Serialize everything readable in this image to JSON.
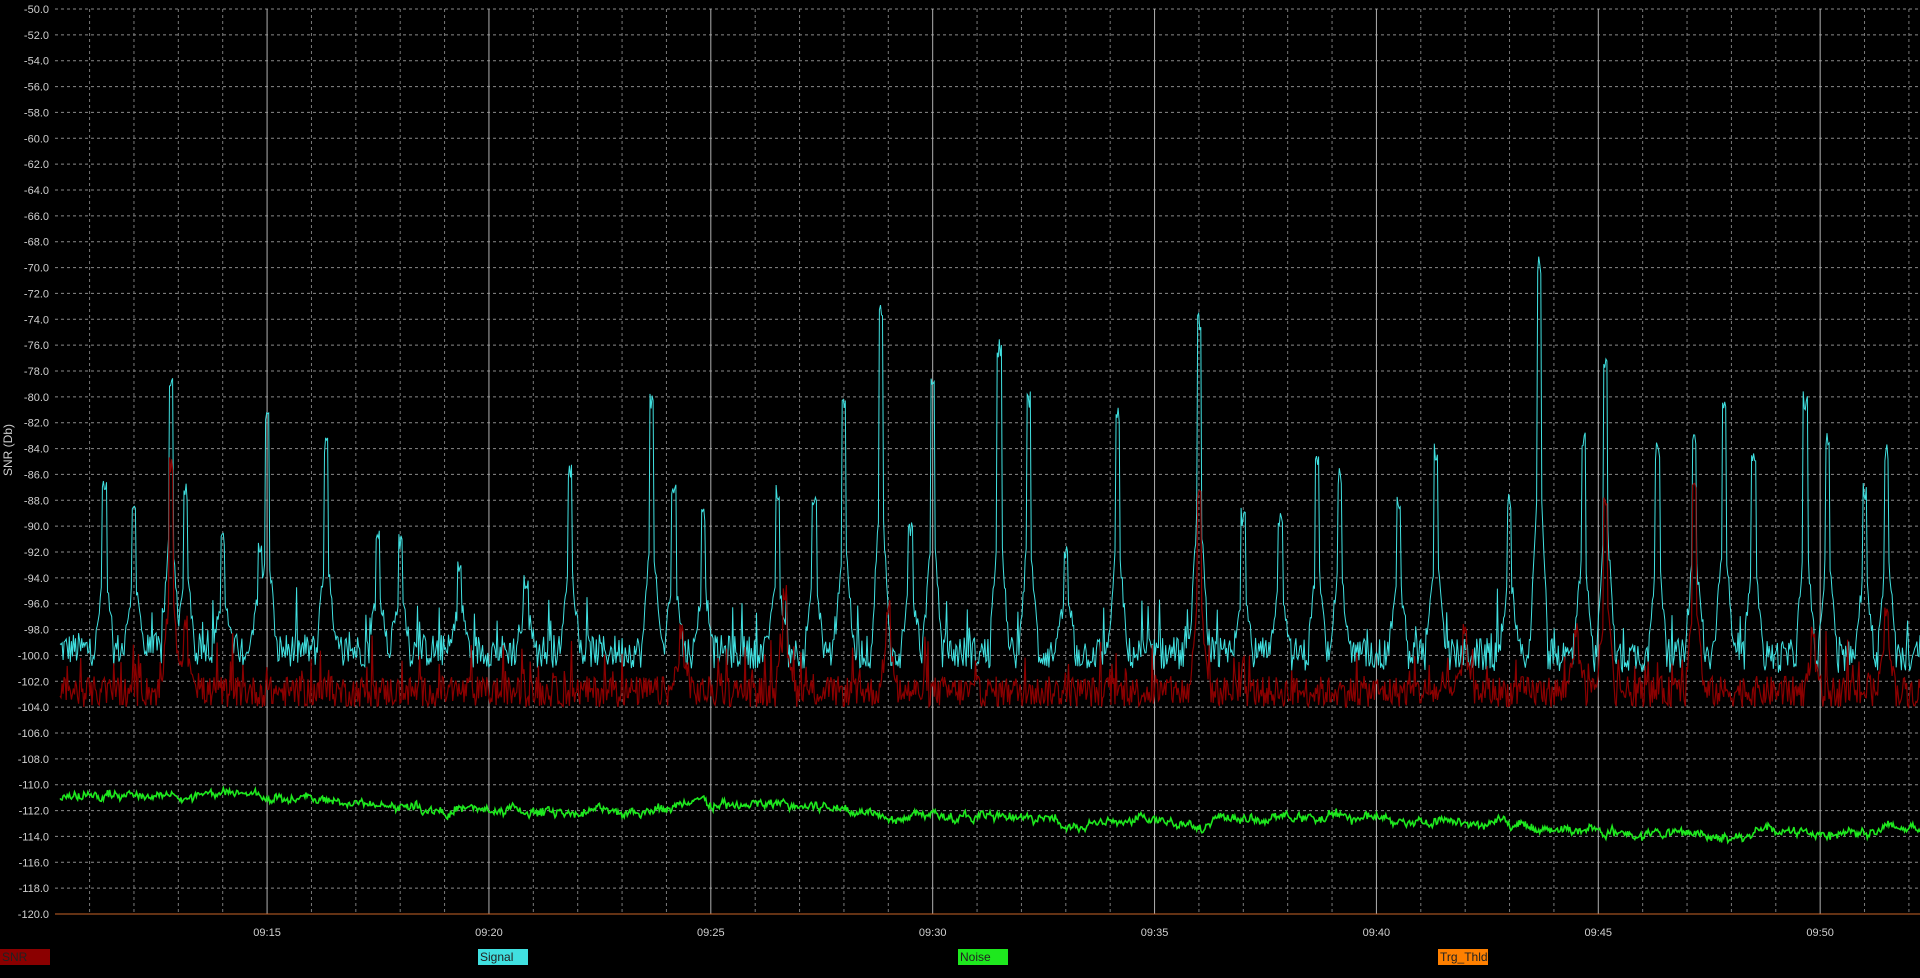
{
  "chart_data": {
    "type": "line",
    "ylabel": "SNR (Db)",
    "ylim": [
      -120,
      -50
    ],
    "yticks": [
      "-50.0",
      "-52.0",
      "-54.0",
      "-56.0",
      "-58.0",
      "-60.0",
      "-62.0",
      "-64.0",
      "-66.0",
      "-68.0",
      "-70.0",
      "-72.0",
      "-74.0",
      "-76.0",
      "-78.0",
      "-80.0",
      "-82.0",
      "-84.0",
      "-86.0",
      "-88.0",
      "-90.0",
      "-92.0",
      "-94.0",
      "-96.0",
      "-98.0",
      "-100.0",
      "-102.0",
      "-104.0",
      "-106.0",
      "-108.0",
      "-110.0",
      "-112.0",
      "-114.0",
      "-116.0",
      "-118.0",
      "-120.0"
    ],
    "xrange": [
      "09:10:20",
      "09:52:15"
    ],
    "xticks": [
      "09:15",
      "09:20",
      "09:25",
      "09:30",
      "09:35",
      "09:40",
      "09:45",
      "09:50"
    ],
    "grid": true,
    "legend_position": "bottom",
    "series": [
      {
        "name": "SNR",
        "color": "#8b0000",
        "baseline": -102.8,
        "peaks": [
          [
            "09:12:50",
            -86
          ],
          [
            "09:13:10",
            -98
          ],
          [
            "09:24:20",
            -99
          ],
          [
            "09:26:40",
            -96
          ],
          [
            "09:29:00",
            -97
          ],
          [
            "09:36:00",
            -88
          ],
          [
            "09:42:00",
            -99
          ],
          [
            "09:44:30",
            -99
          ],
          [
            "09:45:10",
            -89
          ],
          [
            "09:47:10",
            -88
          ],
          [
            "09:49:50",
            -99
          ],
          [
            "09:51:30",
            -97
          ]
        ]
      },
      {
        "name": "Signal",
        "color": "#40e0e0",
        "baseline": -99.5,
        "peaks": [
          [
            "09:11:20",
            -88
          ],
          [
            "09:12:00",
            -89
          ],
          [
            "09:12:50",
            -79.5
          ],
          [
            "09:13:10",
            -88
          ],
          [
            "09:14:00",
            -92
          ],
          [
            "09:14:50",
            -92
          ],
          [
            "09:15:00",
            -82.5
          ],
          [
            "09:16:20",
            -84.5
          ],
          [
            "09:17:30",
            -91
          ],
          [
            "09:18:00",
            -92
          ],
          [
            "09:19:20",
            -94
          ],
          [
            "09:20:50",
            -95
          ],
          [
            "09:21:50",
            -86.5
          ],
          [
            "09:23:40",
            -81
          ],
          [
            "09:24:10",
            -88
          ],
          [
            "09:24:50",
            -90
          ],
          [
            "09:26:30",
            -88
          ],
          [
            "09:27:20",
            -89
          ],
          [
            "09:28:00",
            -81
          ],
          [
            "09:28:50",
            -74
          ],
          [
            "09:29:30",
            -91
          ],
          [
            "09:30:00",
            -80
          ],
          [
            "09:31:30",
            -77
          ],
          [
            "09:32:10",
            -81
          ],
          [
            "09:33:00",
            -93
          ],
          [
            "09:34:10",
            -82
          ],
          [
            "09:36:00",
            -75
          ],
          [
            "09:37:00",
            -90
          ],
          [
            "09:37:50",
            -90
          ],
          [
            "09:38:40",
            -86
          ],
          [
            "09:39:10",
            -87
          ],
          [
            "09:40:30",
            -89
          ],
          [
            "09:41:20",
            -85
          ],
          [
            "09:43:00",
            -89
          ],
          [
            "09:43:40",
            -70.5
          ],
          [
            "09:44:40",
            -84
          ],
          [
            "09:45:10",
            -78.5
          ],
          [
            "09:46:20",
            -85
          ],
          [
            "09:47:10",
            -84
          ],
          [
            "09:47:50",
            -81
          ],
          [
            "09:48:30",
            -85
          ],
          [
            "09:49:40",
            -81
          ],
          [
            "09:50:10",
            -84
          ],
          [
            "09:51:00",
            -88
          ],
          [
            "09:51:30",
            -85
          ]
        ]
      },
      {
        "name": "Noise",
        "color": "#1ee81e",
        "start": -111.0,
        "end": -113.8
      },
      {
        "name": "Trg_Thld",
        "color": "#ff8000",
        "value": -120
      }
    ]
  },
  "legend": [
    {
      "label": "SNR",
      "color": "#8b0000"
    },
    {
      "label": "Signal",
      "color": "#40e0e0"
    },
    {
      "label": "Noise",
      "color": "#1ee81e"
    },
    {
      "label": "Trg_Thld",
      "color": "#ff8000"
    }
  ]
}
